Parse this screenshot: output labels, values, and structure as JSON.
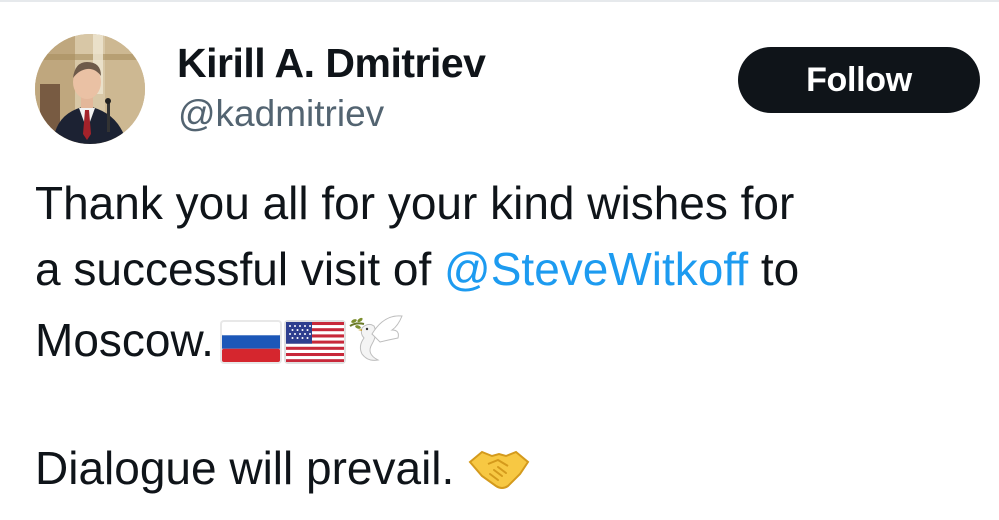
{
  "author": {
    "display_name": "Kirill A. Dmitriev",
    "handle": "@kadmitriev",
    "avatar_icon": "profile-photo"
  },
  "actions": {
    "follow_label": "Follow"
  },
  "tweet": {
    "line1": "Thank you all for your kind wishes for",
    "line2_prefix": "a successful visit of ",
    "mention": "@SteveWitkoff",
    "line2_suffix": " to",
    "line3_text": "Moscow.",
    "line3_emojis": [
      "russia-flag-icon",
      "usa-flag-icon",
      "dove-icon"
    ],
    "line4_text": "Dialogue will prevail.",
    "line4_emojis": [
      "handshake-icon"
    ]
  },
  "colors": {
    "text": "#0f1419",
    "secondary": "#536471",
    "link": "#1d9bf0",
    "button_bg": "#0f1419",
    "button_text": "#ffffff"
  }
}
